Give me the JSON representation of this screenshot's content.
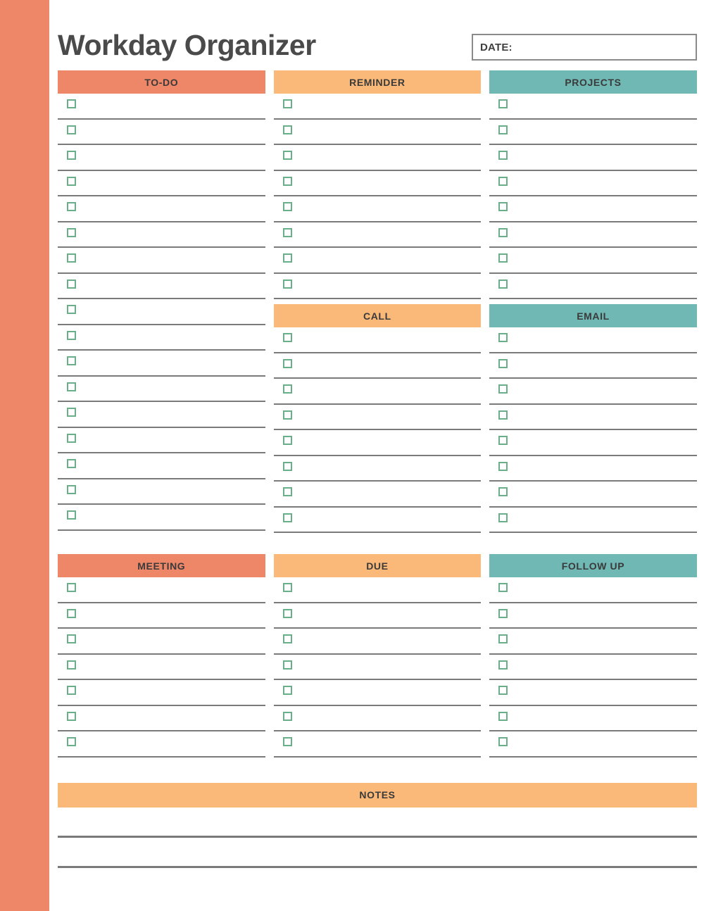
{
  "page": {
    "title": "Workday Organizer",
    "accent_sidebar_color": "#ee8668"
  },
  "date_field": {
    "label": "DATE:",
    "value": "",
    "placeholder": ""
  },
  "palette": {
    "coral": "#ee8668",
    "orange": "#fab978",
    "teal": "#6fb8b4",
    "checkbox_green": "#6bae8a",
    "rule_gray": "#7a7a7a",
    "title_gray": "#4a4a4a"
  },
  "sections": {
    "top": {
      "columns": [
        {
          "label": "TO-DO",
          "color": "coral",
          "rows": 17
        },
        {
          "label": "REMINDER",
          "color": "orange",
          "rows": 8
        },
        {
          "label": "PROJECTS",
          "color": "teal",
          "rows": 8
        }
      ]
    },
    "middle": {
      "columns": [
        {
          "label": "CALL",
          "color": "orange",
          "rows": 8
        },
        {
          "label": "EMAIL",
          "color": "teal",
          "rows": 8
        }
      ]
    },
    "bottom": {
      "columns": [
        {
          "label": "MEETING",
          "color": "coral",
          "rows": 7
        },
        {
          "label": "DUE",
          "color": "orange",
          "rows": 7
        },
        {
          "label": "FOLLOW UP",
          "color": "teal",
          "rows": 7
        }
      ]
    },
    "notes": {
      "label": "NOTES",
      "color": "orange",
      "lines": 2
    }
  }
}
